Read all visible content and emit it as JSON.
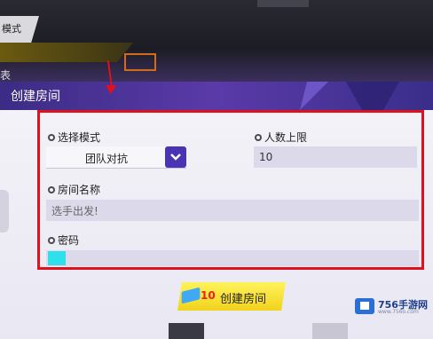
{
  "background": {
    "mode_tab": "模式",
    "left_label": "表"
  },
  "dialog": {
    "title": "创建房间",
    "mode_label": "选择模式",
    "mode_value": "团队对抗",
    "max_players_label": "人数上限",
    "max_players_value": "10",
    "room_name_label": "房间名称",
    "room_name_placeholder": "选手出发!",
    "password_label": "密码"
  },
  "create_button": {
    "cost": "10",
    "label": "创建房间"
  },
  "watermark": {
    "brand": "756手游网",
    "url": "www.756o.com"
  },
  "colors": {
    "header": "#4b34b4",
    "highlight_box": "#e0101c",
    "button": "#f1d21c",
    "cursor": "#2ee0ec"
  }
}
